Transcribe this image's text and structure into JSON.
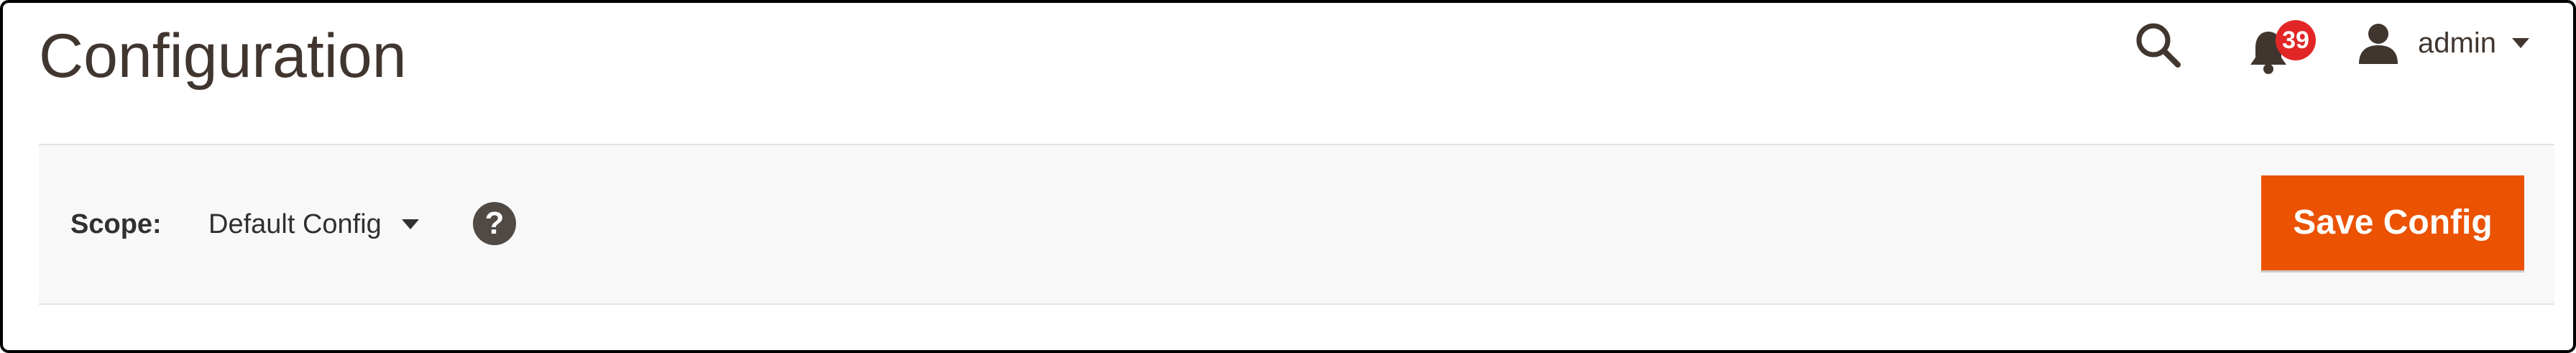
{
  "page": {
    "title": "Configuration"
  },
  "header": {
    "search_icon": "search-icon",
    "notifications": {
      "icon": "bell-icon",
      "count": "39",
      "badge_color": "#e22626"
    },
    "user": {
      "icon": "user-icon",
      "name": "admin"
    }
  },
  "scope": {
    "label": "Scope:",
    "value": "Default Config",
    "help_icon_glyph": "?"
  },
  "actions": {
    "save_label": "Save Config",
    "save_color": "#eb5202"
  },
  "colors": {
    "text": "#41362f",
    "scope_bar_background": "#f8f8f8",
    "help_icon": "#514943"
  }
}
